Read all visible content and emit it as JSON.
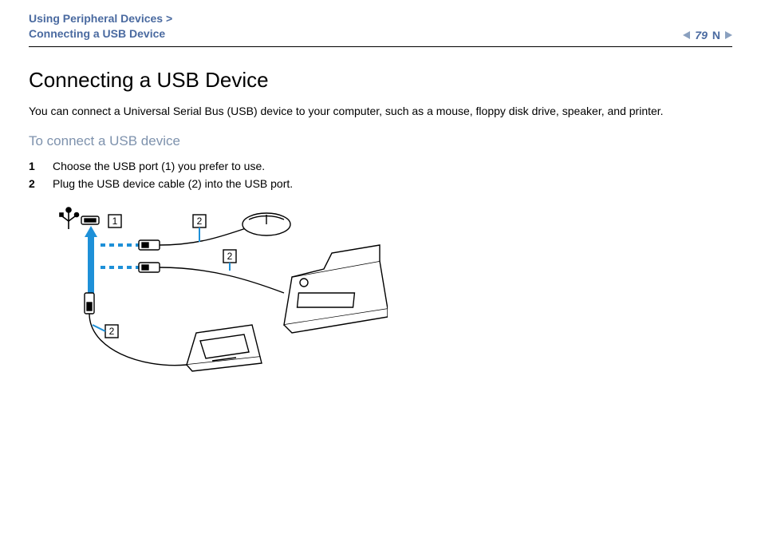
{
  "header": {
    "breadcrumb_section": "Using Peripheral Devices",
    "breadcrumb_sep": " > ",
    "breadcrumb_page": "Connecting a USB Device",
    "page_number": "79"
  },
  "body": {
    "title": "Connecting a USB Device",
    "intro": "You can connect a Universal Serial Bus (USB) device to your computer, such as a mouse, floppy disk drive, speaker, and printer.",
    "subheading": "To connect a USB device",
    "steps": [
      {
        "n": "1",
        "text": "Choose the USB port (1) you prefer to use."
      },
      {
        "n": "2",
        "text": "Plug the USB device cable (2) into the USB port."
      }
    ]
  },
  "figure": {
    "callouts": {
      "port": "1",
      "cable_a": "2",
      "cable_b": "2",
      "cable_c": "2"
    },
    "devices": [
      "mouse",
      "printer",
      "floppy-drive"
    ]
  }
}
